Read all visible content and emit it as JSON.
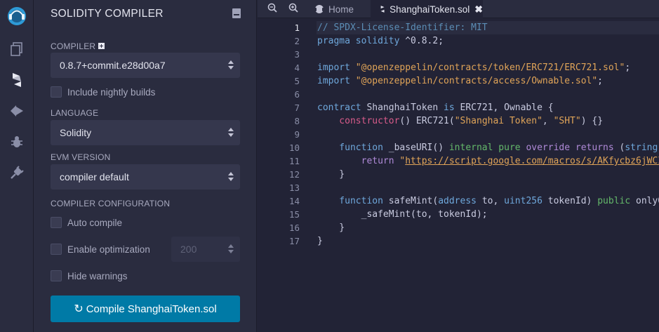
{
  "rail": {
    "icons": [
      "remix-logo-icon",
      "file-explorer-icon",
      "solidity-compiler-icon",
      "deploy-run-icon",
      "debugger-icon",
      "plugin-manager-icon"
    ]
  },
  "panel": {
    "title": "SOLIDITY COMPILER",
    "compiler_label": "COMPILER",
    "compiler_value": "0.8.7+commit.e28d00a7",
    "nightly_label": "Include nightly builds",
    "language_label": "LANGUAGE",
    "language_value": "Solidity",
    "evm_label": "EVM VERSION",
    "evm_value": "compiler default",
    "config_label": "COMPILER CONFIGURATION",
    "auto_compile_label": "Auto compile",
    "optimization_label": "Enable optimization",
    "runs_value": "200",
    "hide_warnings_label": "Hide warnings",
    "compile_button": "Compile ShanghaiToken.sol"
  },
  "tabs": {
    "home": "Home",
    "file": "ShanghaiToken.sol"
  },
  "editor": {
    "active_line": 1,
    "line_numbers": [
      "1",
      "2",
      "3",
      "4",
      "5",
      "6",
      "7",
      "8",
      "9",
      "10",
      "11",
      "12",
      "13",
      "14",
      "15",
      "16",
      "17"
    ]
  },
  "colors": {
    "accent": "#007aa6",
    "background": "#222336",
    "panel": "#2a2c3f"
  }
}
